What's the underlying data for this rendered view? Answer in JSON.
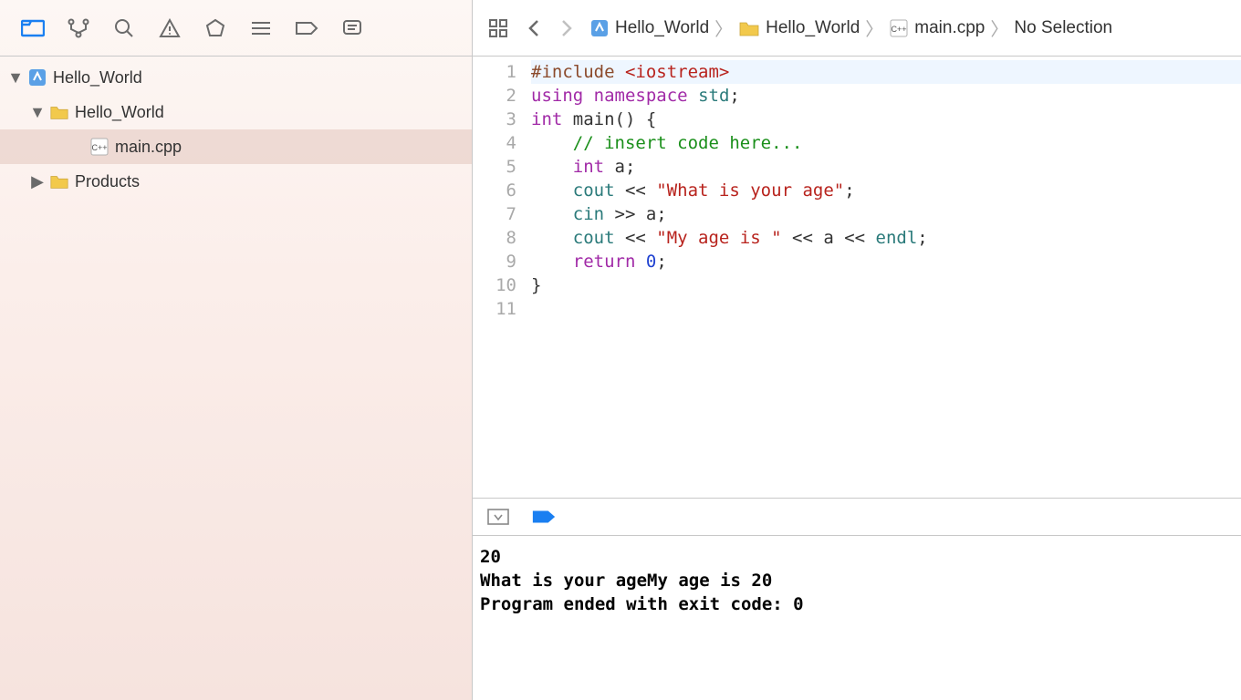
{
  "sidebar": {
    "tabs": [
      {
        "name": "project",
        "selected": true
      },
      {
        "name": "source-control",
        "selected": false
      },
      {
        "name": "search",
        "selected": false
      },
      {
        "name": "issues",
        "selected": false
      },
      {
        "name": "tests",
        "selected": false
      },
      {
        "name": "debug",
        "selected": false
      },
      {
        "name": "breakpoints",
        "selected": false
      },
      {
        "name": "report",
        "selected": false
      }
    ],
    "tree": [
      {
        "level": 0,
        "expanded": true,
        "type": "project",
        "label": "Hello_World"
      },
      {
        "level": 1,
        "expanded": true,
        "type": "folder",
        "label": "Hello_World"
      },
      {
        "level": 2,
        "expanded": null,
        "type": "cpp",
        "label": "main.cpp",
        "selected": true
      },
      {
        "level": 1,
        "expanded": false,
        "type": "folder",
        "label": "Products"
      }
    ]
  },
  "breadcrumb": {
    "items": [
      {
        "type": "project",
        "label": "Hello_World"
      },
      {
        "type": "folder",
        "label": "Hello_World"
      },
      {
        "type": "cpp",
        "label": "main.cpp"
      },
      {
        "type": "none",
        "label": "No Selection"
      }
    ]
  },
  "editor": {
    "highlight_line": 1,
    "lines": [
      {
        "n": 1,
        "tokens": [
          [
            "kw-pre",
            "#include "
          ],
          [
            "str",
            "<iostream>"
          ]
        ]
      },
      {
        "n": 2,
        "tokens": [
          [
            "kw-purple",
            "using"
          ],
          [
            "sym",
            " "
          ],
          [
            "kw-purple",
            "namespace"
          ],
          [
            "sym",
            " "
          ],
          [
            "kw-teal",
            "std"
          ],
          [
            "sym",
            ";"
          ]
        ]
      },
      {
        "n": 3,
        "tokens": [
          [
            "kw-purple",
            "int"
          ],
          [
            "sym",
            " main() {"
          ]
        ]
      },
      {
        "n": 4,
        "tokens": [
          [
            "sym",
            "    "
          ],
          [
            "cmt",
            "// insert code here..."
          ]
        ]
      },
      {
        "n": 5,
        "tokens": [
          [
            "sym",
            "    "
          ],
          [
            "kw-purple",
            "int"
          ],
          [
            "sym",
            " a;"
          ]
        ]
      },
      {
        "n": 6,
        "tokens": [
          [
            "sym",
            "    "
          ],
          [
            "kw-teal",
            "cout"
          ],
          [
            "sym",
            " << "
          ],
          [
            "str",
            "\"What is your age\""
          ],
          [
            "sym",
            ";"
          ]
        ]
      },
      {
        "n": 7,
        "tokens": [
          [
            "sym",
            "    "
          ],
          [
            "kw-teal",
            "cin"
          ],
          [
            "sym",
            " >> a;"
          ]
        ]
      },
      {
        "n": 8,
        "tokens": [
          [
            "sym",
            "    "
          ],
          [
            "kw-teal",
            "cout"
          ],
          [
            "sym",
            " << "
          ],
          [
            "str",
            "\"My age is \""
          ],
          [
            "sym",
            " << a << "
          ],
          [
            "kw-teal",
            "endl"
          ],
          [
            "sym",
            ";"
          ]
        ]
      },
      {
        "n": 9,
        "tokens": [
          [
            "sym",
            "    "
          ],
          [
            "kw-purple",
            "return"
          ],
          [
            "sym",
            " "
          ],
          [
            "num",
            "0"
          ],
          [
            "sym",
            ";"
          ]
        ]
      },
      {
        "n": 10,
        "tokens": [
          [
            "sym",
            "}"
          ]
        ]
      },
      {
        "n": 11,
        "tokens": [
          [
            "sym",
            ""
          ]
        ]
      }
    ]
  },
  "console": {
    "lines": [
      "20",
      "What is your ageMy age is 20",
      "Program ended with exit code: 0"
    ]
  }
}
